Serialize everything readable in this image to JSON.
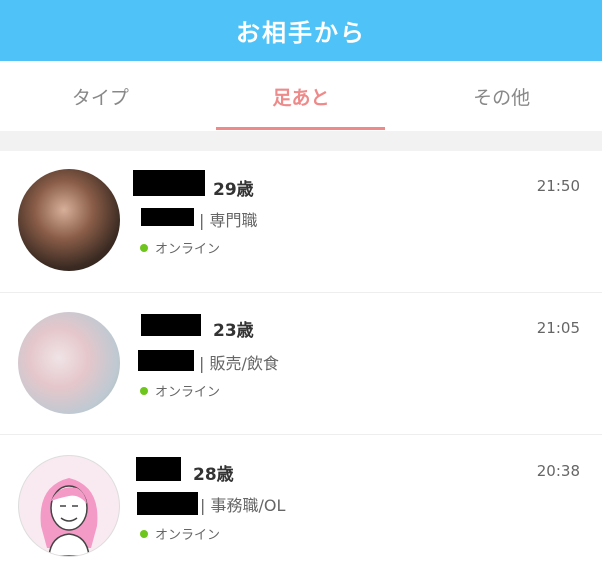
{
  "header": {
    "title": "お相手から"
  },
  "tabs": [
    {
      "label": "タイプ",
      "active": false
    },
    {
      "label": "足あと",
      "active": true
    },
    {
      "label": "その他",
      "active": false
    }
  ],
  "items": [
    {
      "age": "29歳",
      "job": "| 専門職",
      "status": "オンライン",
      "time": "21:50",
      "avatar": "photo"
    },
    {
      "age": "23歳",
      "job": "| 販売/飲食",
      "status": "オンライン",
      "time": "21:05",
      "avatar": "photo"
    },
    {
      "age": "28歳",
      "job": "| 事務職/OL",
      "status": "オンライン",
      "time": "20:38",
      "avatar": "illustration"
    }
  ],
  "colors": {
    "header": "#4fc3f7",
    "accent": "#ee8a8a",
    "online": "#6ec51c"
  }
}
